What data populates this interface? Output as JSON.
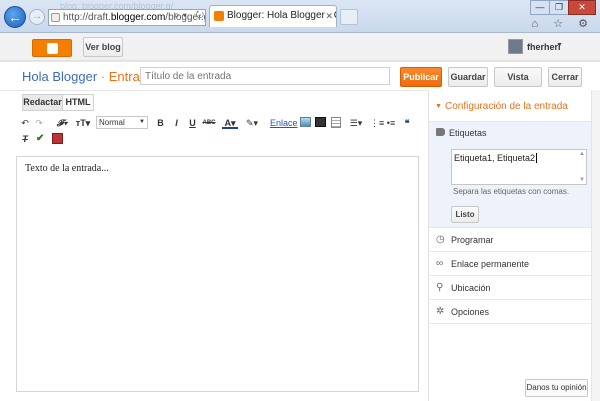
{
  "browser": {
    "ghost_text": "blog: blogger.com/blogger.g/",
    "address_prefix": "http://draft.",
    "address_domain": "blogger.com",
    "address_suffix": "/blogger.g",
    "tab_title": "Blogger: Hola Blogger - Cre...",
    "tab_close": "✕",
    "win_min": "—",
    "win_max": "❐",
    "win_close": "✕",
    "tools": "⌂ ☆ ⚙"
  },
  "header": {
    "view_blog": "Ver blog",
    "username": "fherheri"
  },
  "title_bar": {
    "blog_name": "Hola Blogger",
    "separator": "·",
    "section": "Entrada",
    "post_title_placeholder": "Título de la entrada",
    "publish": "Publicar",
    "save": "Guardar",
    "preview": "Vista previa",
    "close": "Cerrar"
  },
  "editor": {
    "tab_compose": "Redactar",
    "tab_html": "HTML",
    "font_size": "Normal",
    "bold": "B",
    "italic": "I",
    "underline": "U",
    "strike": "ABC",
    "link": "Enlace",
    "content_placeholder": "Texto de la entrada..."
  },
  "settings": {
    "heading": "Configuración de la entrada",
    "labels_title": "Etiquetas",
    "labels_value": "Etiqueta1, Etiqueta2",
    "labels_hint": "Separa las etiquetas con comas.",
    "done": "Listo",
    "items": [
      {
        "label": "Programar",
        "icon": "clock-icon"
      },
      {
        "label": "Enlace permanente",
        "icon": "link-icon"
      },
      {
        "label": "Ubicación",
        "icon": "pin-icon"
      },
      {
        "label": "Opciones",
        "icon": "gear-icon"
      }
    ]
  },
  "feedback": "Danos tu opinión",
  "colors": {
    "accent_orange": "#f57d00",
    "blog_blue": "#3d6bb8",
    "link_blue": "#2255cc"
  }
}
